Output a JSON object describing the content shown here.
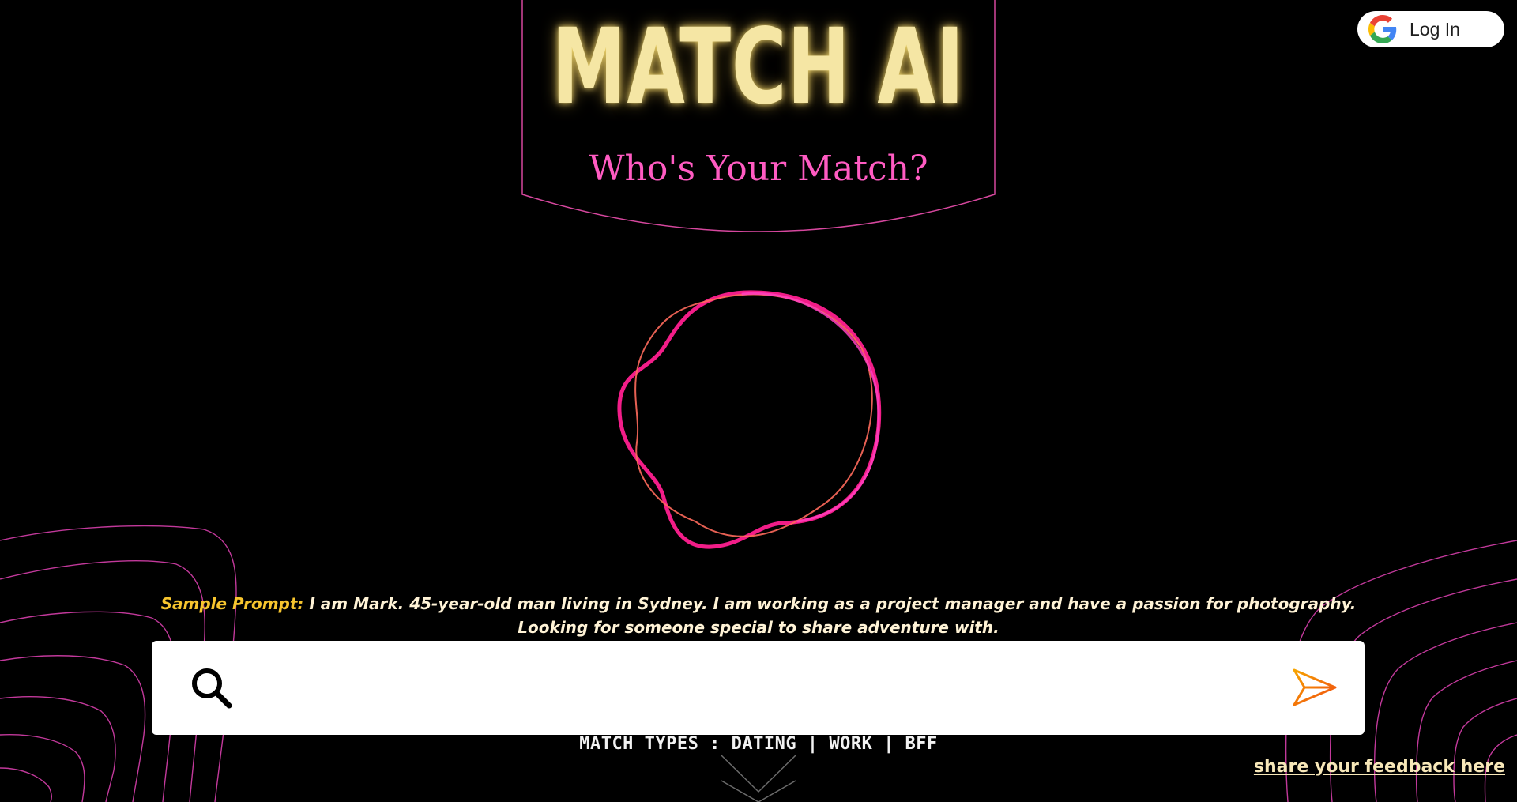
{
  "header": {
    "login_label": "Log In",
    "title": "MATCH AI",
    "subtitle": "Who's Your Match?"
  },
  "prompt": {
    "label": "Sample Prompt:",
    "text": " I am Mark. 45-year-old man living in Sydney. I am working as a project manager and have a passion for photography. Looking for someone special to share adventure with."
  },
  "search": {
    "value": "",
    "placeholder": ""
  },
  "footer": {
    "match_types": "MATCH TYPES : DATING | WORK | BFF",
    "feedback_link": "share your feedback here"
  },
  "colors": {
    "background": "#000000",
    "title": "#f5e6a4",
    "subtitle": "#ff5bc2",
    "accent_pink": "#ff2d95",
    "prompt_label": "#f7c52e",
    "send_arrow": "#f57c00"
  },
  "icons": {
    "login": "google-g-icon",
    "search": "search-icon",
    "send": "send-arrow-icon",
    "scroll": "chevron-down-icon"
  }
}
